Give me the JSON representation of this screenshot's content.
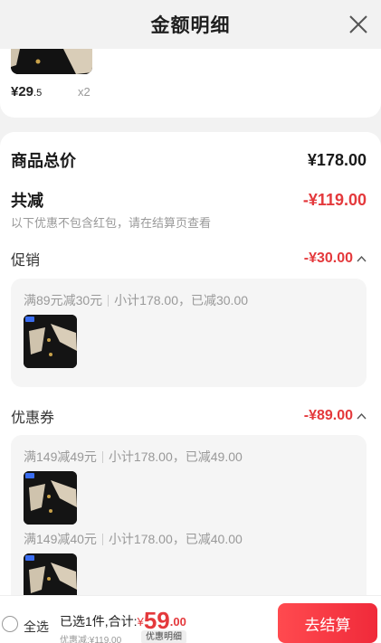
{
  "header": {
    "title": "金额明细"
  },
  "product": {
    "price_symbol": "¥",
    "price_int": "29",
    "price_dec": ".5",
    "qty": "x2"
  },
  "detail": {
    "total_label": "商品总价",
    "total_value": "¥178.00",
    "reduce_label": "共减",
    "reduce_value": "-¥119.00",
    "reduce_hint": "以下优惠不包含红包，请在结算页查看",
    "promo": {
      "label": "促销",
      "value": "-¥30.00",
      "items": [
        {
          "rule": "满89元减30元",
          "sub": "小计178.00，已减30.00"
        }
      ]
    },
    "coupon": {
      "label": "优惠券",
      "value": "-¥89.00",
      "items": [
        {
          "rule": "满149减49元",
          "sub": "小计178.00，已减49.00"
        },
        {
          "rule": "满149减40元",
          "sub": "小计178.00，已减40.00"
        }
      ]
    }
  },
  "bottom": {
    "select_all": "全选",
    "selected_text": "已选1件,合计:",
    "currency": "¥",
    "amount_int": "59",
    "amount_dec": ".00",
    "discount_text": "优惠减:¥119.00",
    "detail_chip": "优惠明细",
    "checkout": "去结算"
  },
  "colors": {
    "accent_red": "#e4393c",
    "checkout_gradient_start": "#ff4a4f",
    "checkout_gradient_end": "#f02a3a"
  },
  "icons": [
    "close-icon",
    "chevron-up-icon",
    "radio-icon"
  ]
}
